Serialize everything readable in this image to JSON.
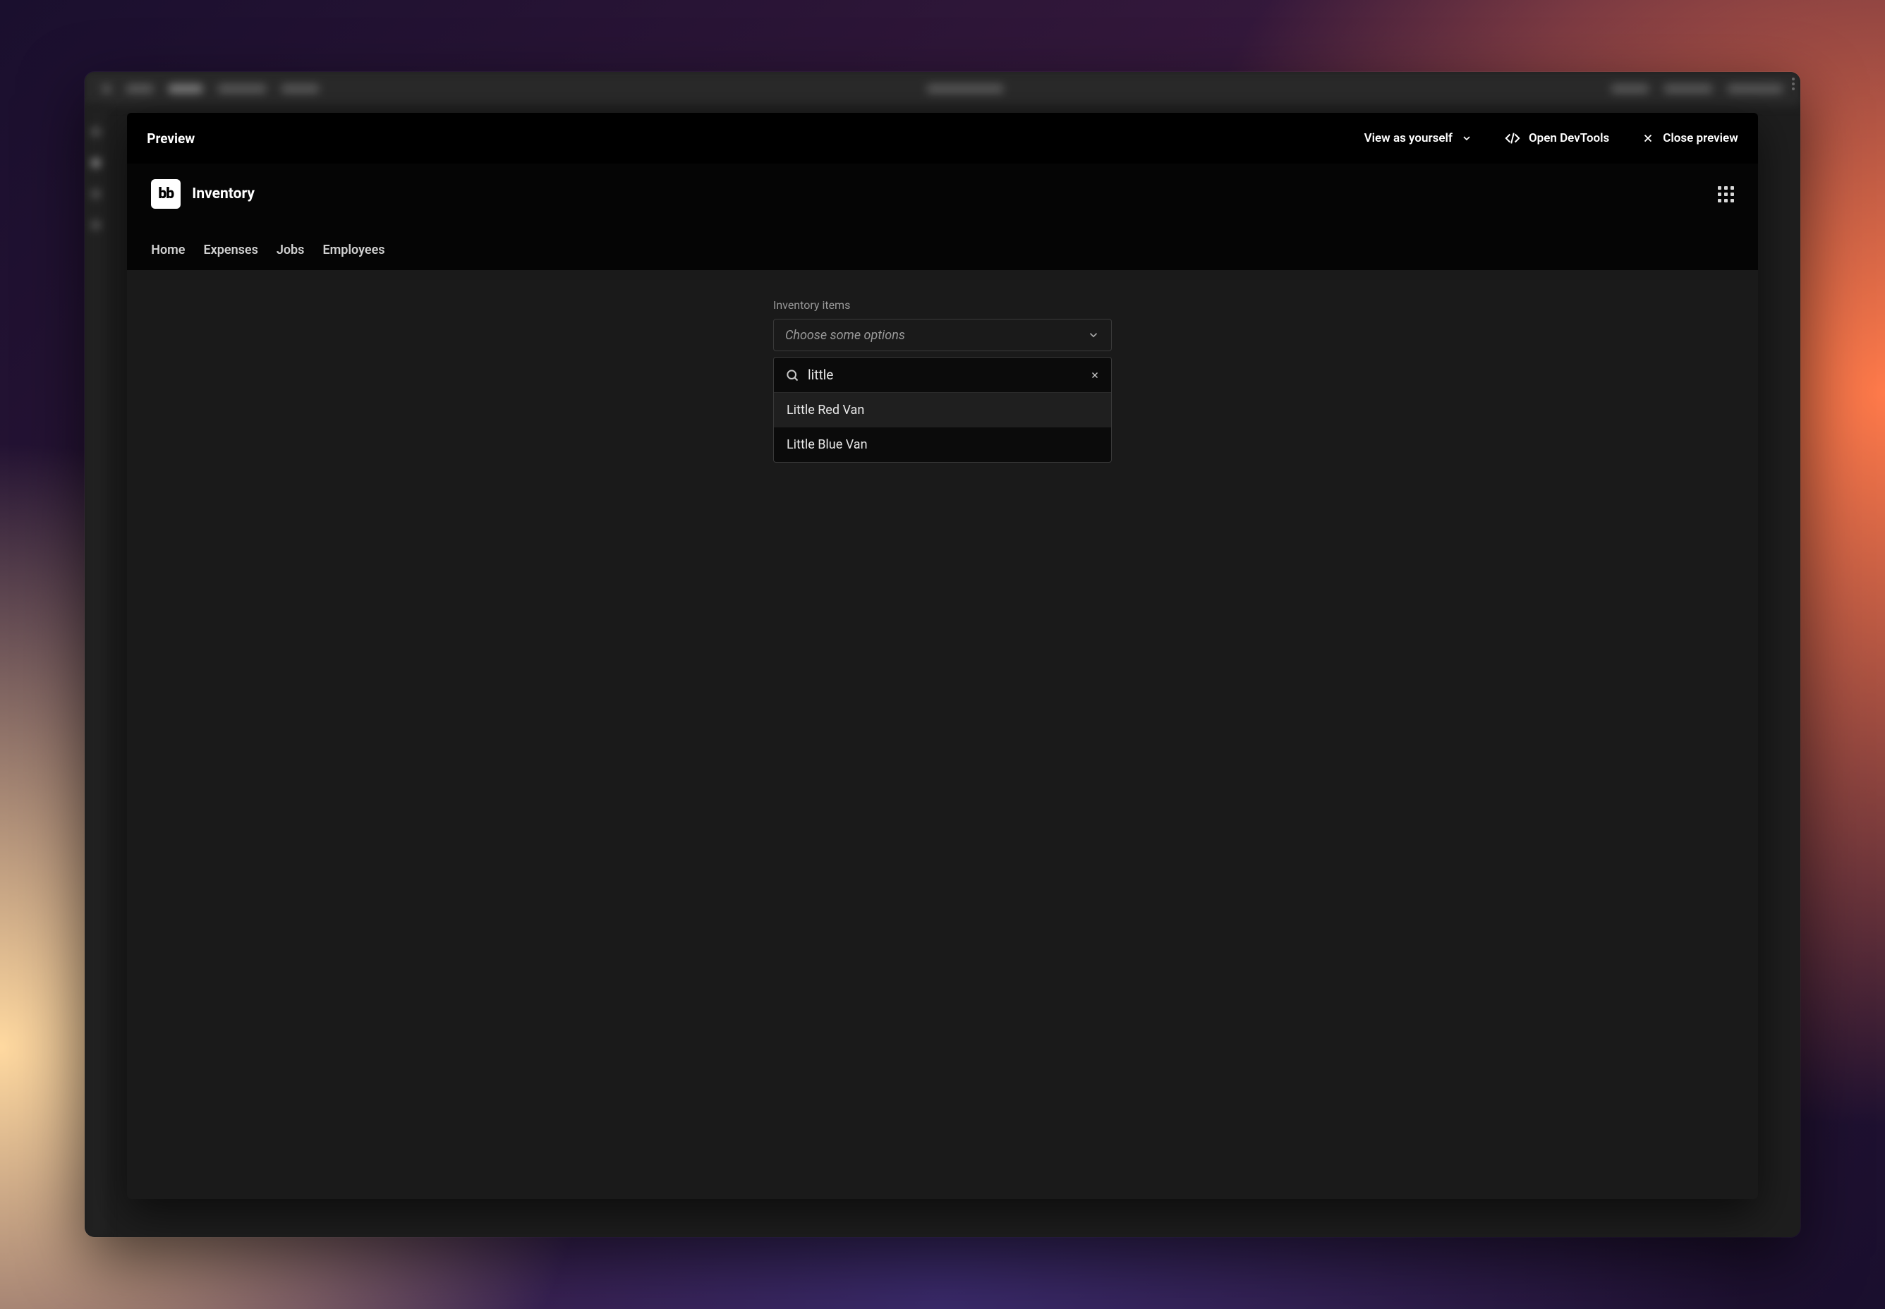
{
  "preview_bar": {
    "title": "Preview",
    "view_as": "View as yourself",
    "devtools": "Open DevTools",
    "close": "Close preview"
  },
  "app": {
    "logo_text": "bb",
    "title": "Inventory",
    "nav": [
      "Home",
      "Expenses",
      "Jobs",
      "Employees"
    ]
  },
  "form": {
    "label": "Inventory items",
    "placeholder": "Choose some options",
    "search_value": "little",
    "options": [
      {
        "label": "Little Red Van",
        "highlighted": true
      },
      {
        "label": "Little Blue Van",
        "highlighted": false
      }
    ]
  }
}
